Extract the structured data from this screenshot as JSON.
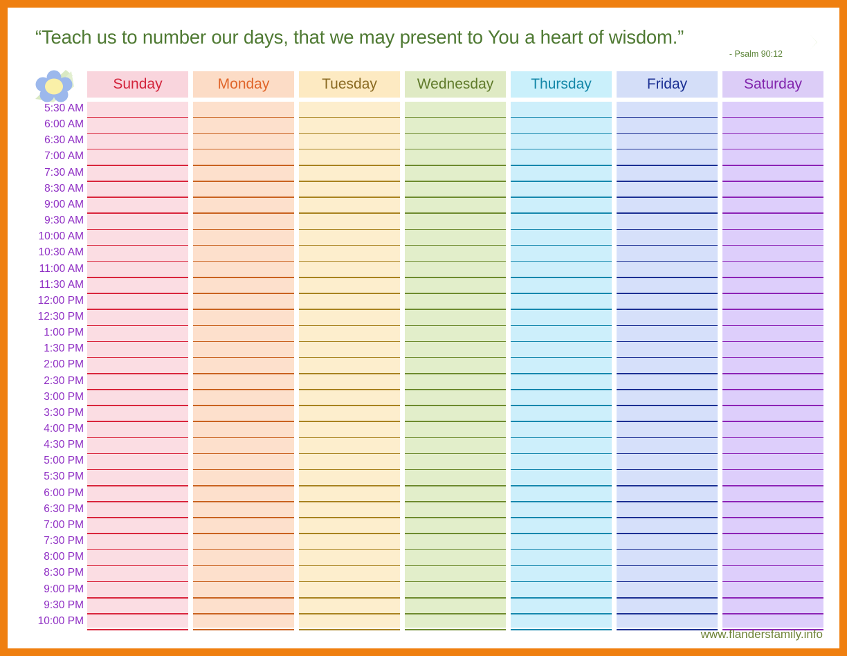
{
  "page": {
    "border_color": "#ef7f10",
    "background": "#ffffff"
  },
  "banner": {
    "quote": "“Teach us to number our days, that we may present to You a heart of wisdom.”",
    "attribution": "- Psalm 90:12",
    "background": "#cfe3b0",
    "text_color": "#4f7a33"
  },
  "corner": {
    "icon": "flower-icon",
    "petal_color": "#9cb8ec",
    "center_color": "#faf0a8",
    "leaf_color": "#d7e8c0"
  },
  "columns": [
    {
      "label": "Sunday",
      "head_bg": "#f9d5dd",
      "body_bg": "#fbdde3",
      "text": "#d3243c",
      "line": "#d9253c"
    },
    {
      "label": "Monday",
      "head_bg": "#fcdcc6",
      "body_bg": "#fde0cc",
      "text": "#e0652a",
      "line": "#c9621f"
    },
    {
      "label": "Tuesday",
      "head_bg": "#fdeac2",
      "body_bg": "#fdeecd",
      "text": "#8a6a22",
      "line": "#a8821f"
    },
    {
      "label": "Wednesday",
      "head_bg": "#dfeac4",
      "body_bg": "#e2eeca",
      "text": "#5f7a2a",
      "line": "#6d8a2e"
    },
    {
      "label": "Thursday",
      "head_bg": "#caf0fb",
      "body_bg": "#cdeffb",
      "text": "#1487a8",
      "line": "#1587ad"
    },
    {
      "label": "Friday",
      "head_bg": "#d4def8",
      "body_bg": "#d6e0fa",
      "text": "#1a2f93",
      "line": "#1b2f93"
    },
    {
      "label": "Saturday",
      "head_bg": "#dccdf7",
      "body_bg": "#ddcefb",
      "text": "#8226ad",
      "line": "#8c22b5"
    }
  ],
  "times": [
    "5:30 AM",
    "6:00 AM",
    "6:30  AM",
    "7:00 AM",
    "7:30 AM",
    "8:30 AM",
    "9:00 AM",
    "9:30 AM",
    "10:00 AM",
    "10:30 AM",
    "11:00 AM",
    "11:30 AM",
    "12:00 PM",
    "12:30 PM",
    "1:00 PM",
    "1:30 PM",
    "2:00 PM",
    "2:30 PM",
    "3:00 PM",
    "3:30 PM",
    "4:00 PM",
    "4:30 PM",
    "5:00 PM",
    "5:30 PM",
    "6:00 PM",
    "6:30 PM",
    "7:00 PM",
    "7:30 PM",
    "8:00 PM",
    "8:30 PM",
    "9:00 PM",
    "9:30 PM",
    "10:00 PM"
  ],
  "time_label_color": "#8f2ec4",
  "footer": {
    "url": "www.flandersfamily.info",
    "color": "#6f8438"
  }
}
